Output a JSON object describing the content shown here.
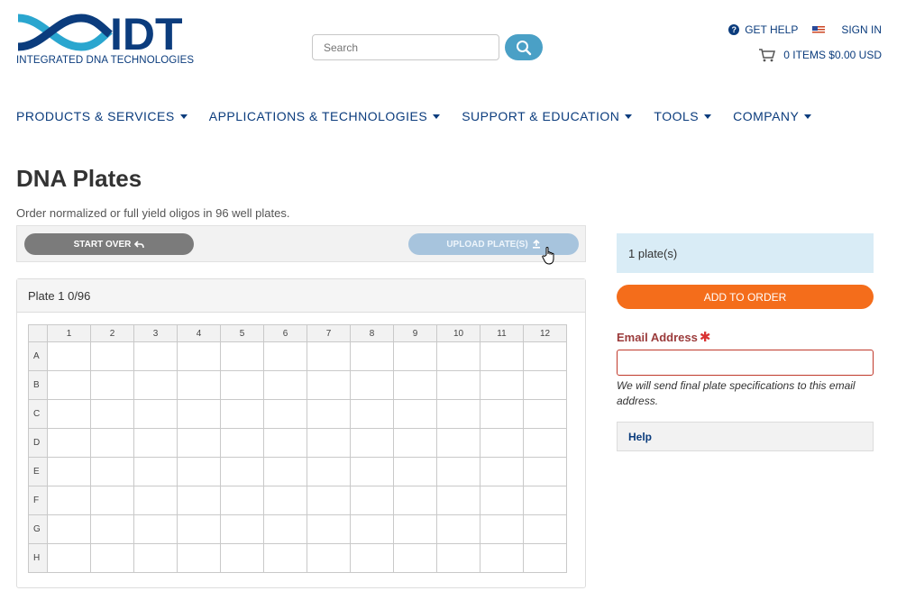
{
  "header": {
    "logo_text": "IDT",
    "logo_subtitle": "INTEGRATED DNA TECHNOLOGIES",
    "search_placeholder": "Search",
    "get_help": "GET HELP",
    "sign_in": "SIGN IN",
    "cart": "0 ITEMS $0.00 USD"
  },
  "nav": {
    "items": [
      {
        "label": "PRODUCTS & SERVICES"
      },
      {
        "label": "APPLICATIONS & TECHNOLOGIES"
      },
      {
        "label": "SUPPORT & EDUCATION"
      },
      {
        "label": "TOOLS"
      },
      {
        "label": "COMPANY"
      }
    ]
  },
  "page": {
    "title": "DNA Plates",
    "subtitle": "Order normalized or full yield oligos in 96 well plates."
  },
  "actions": {
    "start_over": "START OVER",
    "upload": "UPLOAD PLATE(S)"
  },
  "plate": {
    "header": "Plate 1 0/96",
    "columns": [
      "1",
      "2",
      "3",
      "4",
      "5",
      "6",
      "7",
      "8",
      "9",
      "10",
      "11",
      "12"
    ],
    "rows": [
      "A",
      "B",
      "C",
      "D",
      "E",
      "F",
      "G",
      "H"
    ]
  },
  "sidebar": {
    "plates_count": "1 plate(s)",
    "add_to_order": "ADD TO ORDER",
    "email_label": "Email Address",
    "email_note": "We will send final plate specifications to this email address.",
    "help": "Help"
  },
  "colors": {
    "brand_navy": "#0b3c7d",
    "accent_orange": "#f46d1b",
    "info_blue": "#d9ecf6",
    "required_red": "#c0392b"
  }
}
